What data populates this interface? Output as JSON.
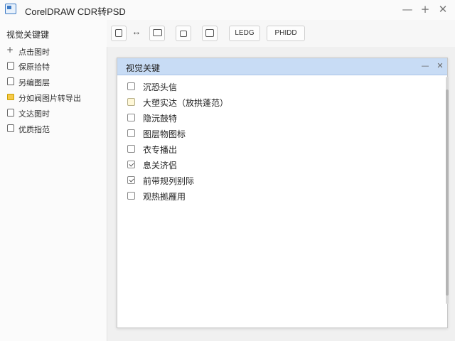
{
  "window": {
    "title": "CorelDRAW CDR转PSD",
    "minimize_glyph": "—",
    "maximize_glyph": "+",
    "close_glyph": "✕"
  },
  "sidebar": {
    "title": "视觉关键键",
    "items": [
      {
        "label": "点击图时",
        "icon": "plus-icon"
      },
      {
        "label": "保原拾特",
        "icon": "doc-icon"
      },
      {
        "label": "另编图层",
        "icon": "layers-icon"
      },
      {
        "label": "分如阀图片转导出",
        "icon": "folder-icon"
      },
      {
        "label": "文达图时",
        "icon": "doc-icon"
      },
      {
        "label": "优质指范",
        "icon": "doc-icon"
      }
    ]
  },
  "toolbar": {
    "move_glyph": "↔",
    "btn_ledg": "LEDG",
    "btn_phidd": "PHIDD",
    "icons": [
      "frame-icon",
      "move-icon",
      "image-icon",
      "lock-icon",
      "copy-icon"
    ]
  },
  "dialog": {
    "title": "视觉关键",
    "min_glyph": "—",
    "close_glyph": "✕",
    "options": [
      {
        "label": "沉恐头信",
        "checked": false,
        "tinted": false
      },
      {
        "label": "大塑实达（放拱蓬范）",
        "checked": false,
        "tinted": true
      },
      {
        "label": "隐沅鼓特",
        "checked": false,
        "tinted": false
      },
      {
        "label": "图层物图标",
        "checked": false,
        "tinted": false
      },
      {
        "label": "衣专播出",
        "checked": false,
        "tinted": false
      },
      {
        "label": "息关济侣",
        "checked": true,
        "tinted": false
      },
      {
        "label": "前带规列别际",
        "checked": true,
        "tinted": false
      },
      {
        "label": "观热拠雁用",
        "checked": false,
        "tinted": false
      }
    ]
  },
  "colors": {
    "dialog_header": "#c8dcf5",
    "folder_icon": "#f7c948",
    "app_icon": "#3b79c4"
  }
}
